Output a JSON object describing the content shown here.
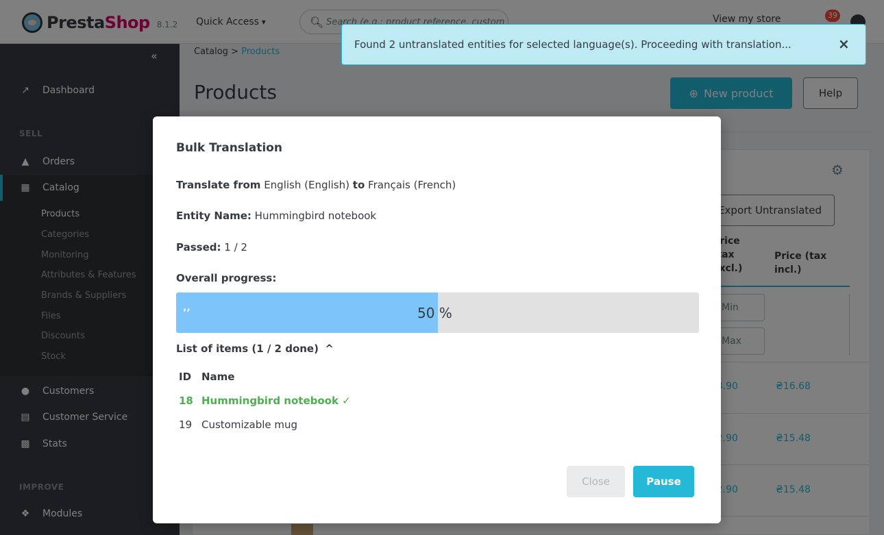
{
  "header": {
    "logo_text_presta": "Presta",
    "logo_text_shop": "Shop",
    "version": "8.1.2",
    "quick_access": "Quick Access",
    "search_placeholder": "Search (e.g.: product reference, custom",
    "view_store": "View my store",
    "notifications_count": "39"
  },
  "sidebar": {
    "collapse_icon": "«",
    "dashboard": "Dashboard",
    "section_sell": "SELL",
    "orders": "Orders",
    "catalog": "Catalog",
    "catalog_sub": [
      "Products",
      "Categories",
      "Monitoring",
      "Attributes & Features",
      "Brands & Suppliers",
      "Files",
      "Discounts",
      "Stock"
    ],
    "customers": "Customers",
    "customer_service": "Customer Service",
    "stats": "Stats",
    "section_improve": "IMPROVE",
    "modules": "Modules"
  },
  "page": {
    "breadcrumb_parent": "Catalog",
    "breadcrumb_sep": ">",
    "breadcrumb_current": "Products",
    "title": "Products",
    "new_product": "New product",
    "help": "Help",
    "export_untranslated": "Export Untranslated",
    "col_price_excl": [
      "Price",
      "(tax",
      "excl.)"
    ],
    "col_price_incl": [
      "Price (tax",
      "incl.)"
    ],
    "filter_min": "Min",
    "filter_max": "Max",
    "rows": [
      {
        "price_excl": "₴13.90",
        "price_incl": "₴16.68"
      },
      {
        "price_excl": "₴12.90",
        "price_incl": "₴15.48"
      },
      {
        "price_excl": "₴12.90",
        "price_incl": "₴15.48"
      }
    ]
  },
  "toast": {
    "message": "Found 2 untranslated entities for selected language(s). Proceeding with translation...",
    "close": "×"
  },
  "modal": {
    "title": "Bulk Translation",
    "translate_from_label": "Translate from",
    "from_lang": "English (English)",
    "to_label": "to",
    "to_lang": "Français (French)",
    "entity_label": "Entity Name:",
    "entity_value": "Hummingbird notebook",
    "passed_label": "Passed:",
    "passed_value": "1 / 2",
    "overall_label": "Overall progress:",
    "progress_percent": 50,
    "progress_text": "50 %",
    "list_label": "List of items (1 / 2 done)",
    "list_caret": "^",
    "col_id": "ID",
    "col_name": "Name",
    "items": [
      {
        "id": "18",
        "name": "Hummingbird notebook ✓",
        "done": true
      },
      {
        "id": "19",
        "name": "Customizable mug",
        "done": false
      }
    ],
    "close_button": "Close",
    "pause_button": "Pause"
  },
  "colors": {
    "accent": "#25b9d7",
    "sidebar_bg": "#363a41",
    "progress_fill": "#7cc4fa",
    "success": "#4caf50",
    "toast_bg": "#beeaf3"
  }
}
